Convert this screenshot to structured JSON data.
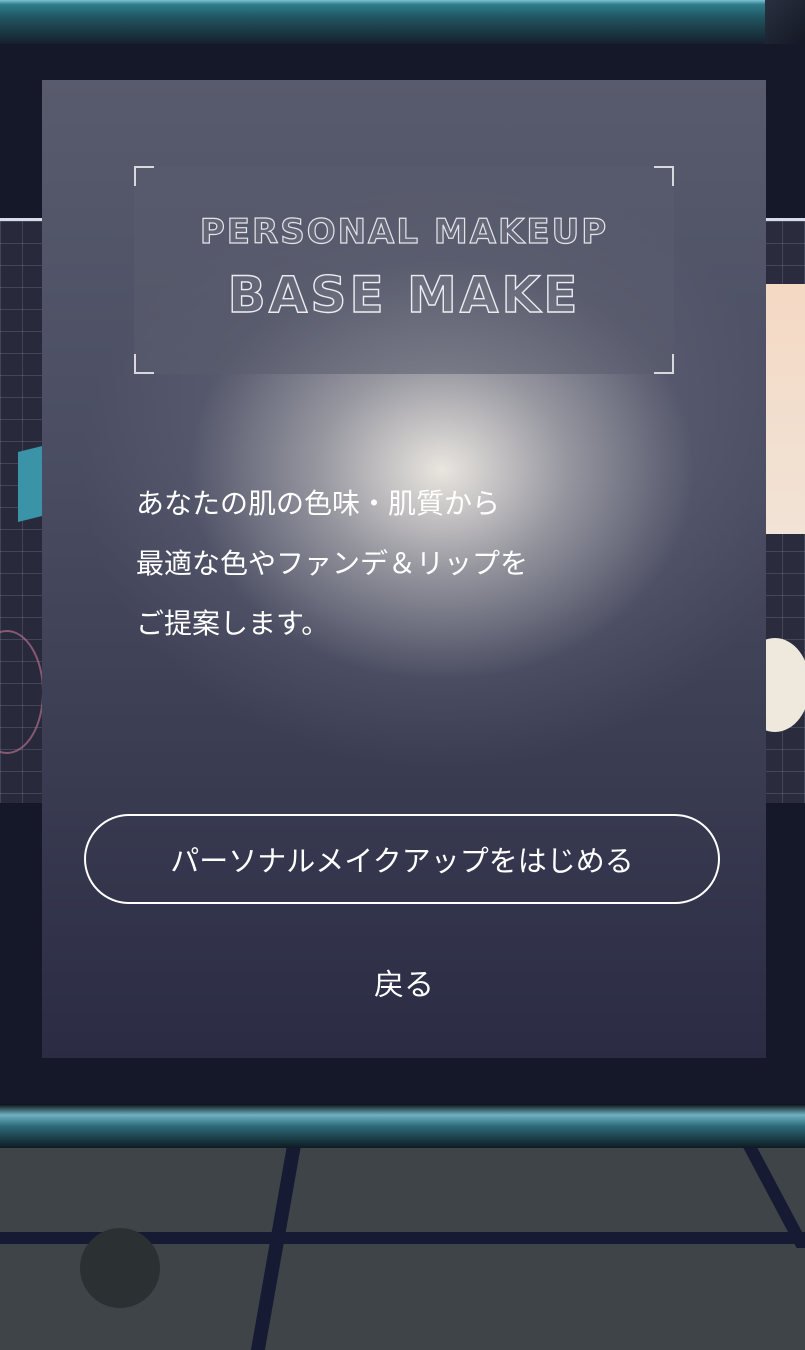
{
  "modal": {
    "title_line1": "PERSONAL MAKEUP",
    "title_line2": "BASE MAKE",
    "description": [
      "あなたの肌の色味・肌質から",
      "最適な色やファンデ＆リップを",
      "ご提案します。"
    ],
    "start_button_label": "パーソナルメイクアップをはじめる",
    "back_label": "戻る"
  },
  "colors": {
    "accent_teal": "#3a93a6",
    "panel_dark": "#2b2c44",
    "text": "#ffffff"
  }
}
